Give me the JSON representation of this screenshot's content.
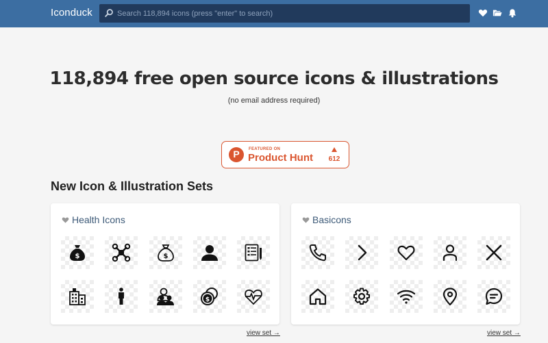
{
  "header": {
    "brand": "Iconduck",
    "search_placeholder": "Search 118,894 icons (press \"enter\" to search)",
    "nav_icons": [
      "heart-icon",
      "folder-icon",
      "bell-icon"
    ]
  },
  "hero": {
    "title": "118,894 free open source icons & illustrations",
    "subtitle": "(no email address required)"
  },
  "product_hunt": {
    "featured": "FEATURED ON",
    "name": "Product Hunt",
    "logo_letter": "P",
    "count": "612",
    "color": "#da552f"
  },
  "sets_section": {
    "title": "New Icon & Illustration Sets",
    "sets": [
      {
        "title": "Health Icons",
        "link": "view set →",
        "icons": [
          "money-bag-icon",
          "drone-icon",
          "money-bag-outline-icon",
          "person-icon",
          "medical-report-icon",
          "hospital-building-icon",
          "standing-person-icon",
          "group-icon",
          "coins-icon",
          "heart-pulse-icon"
        ]
      },
      {
        "title": "Basicons",
        "link": "view set →",
        "icons": [
          "phone-icon",
          "chevron-right-icon",
          "heart-outline-icon",
          "user-icon",
          "close-icon",
          "home-icon",
          "settings-icon",
          "wifi-icon",
          "location-pin-icon",
          "chat-bubble-icon"
        ]
      }
    ]
  },
  "colors": {
    "header_bg": "#3c6ea2",
    "search_bg": "#213a5c",
    "page_bg": "#f5f5f5",
    "set_title": "#3d5a78"
  }
}
